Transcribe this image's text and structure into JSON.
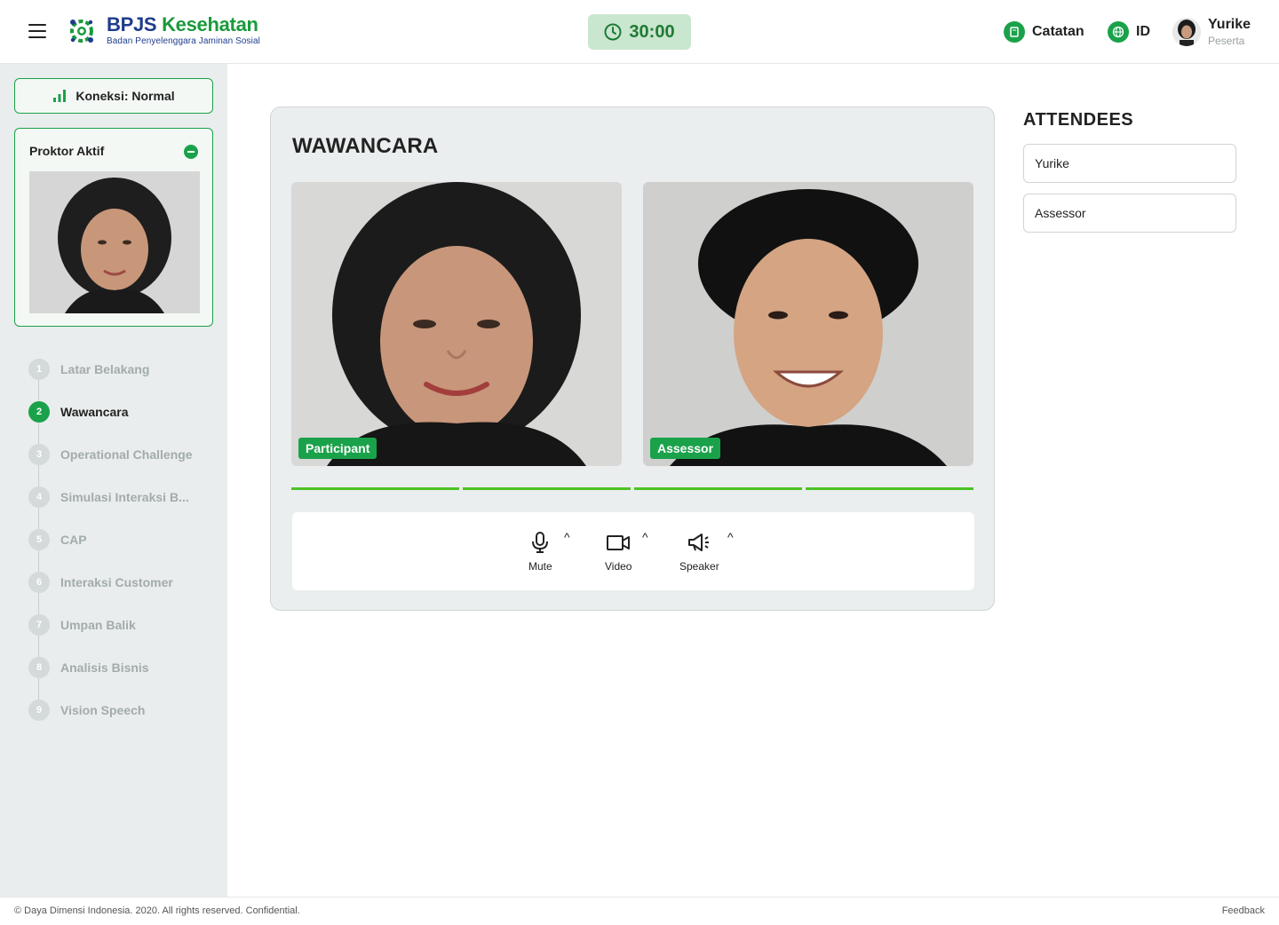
{
  "header": {
    "logo": {
      "title_part1": "BPJS",
      "title_part2": "Kesehatan",
      "subtitle": "Badan Penyelenggara Jaminan Sosial"
    },
    "timer": "30:00",
    "notes_label": "Catatan",
    "language": "ID",
    "user": {
      "name": "Yurike",
      "role": "Peserta"
    }
  },
  "sidebar": {
    "connection": "Koneksi: Normal",
    "proctor_title": "Proktor Aktif",
    "steps": [
      {
        "num": "1",
        "label": "Latar Belakang",
        "active": false
      },
      {
        "num": "2",
        "label": "Wawancara",
        "active": true
      },
      {
        "num": "3",
        "label": "Operational Challenge",
        "active": false
      },
      {
        "num": "4",
        "label": "Simulasi Interaksi B...",
        "active": false
      },
      {
        "num": "5",
        "label": "CAP",
        "active": false
      },
      {
        "num": "6",
        "label": "Interaksi Customer",
        "active": false
      },
      {
        "num": "7",
        "label": "Umpan Balik",
        "active": false
      },
      {
        "num": "8",
        "label": "Analisis Bisnis",
        "active": false
      },
      {
        "num": "9",
        "label": "Vision Speech",
        "active": false
      }
    ]
  },
  "main": {
    "title": "WAWANCARA",
    "videos": [
      {
        "label": "Participant"
      },
      {
        "label": "Assessor"
      }
    ],
    "controls": {
      "mute": "Mute",
      "video": "Video",
      "speaker": "Speaker",
      "caret": "^"
    }
  },
  "attendees": {
    "title": "ATTENDEES",
    "items": [
      "Yurike",
      "Assessor"
    ]
  },
  "footer": {
    "copyright": "© Daya Dimensi Indonesia. 2020. All rights reserved. Confidential.",
    "feedback": "Feedback"
  },
  "colors": {
    "brand_green": "#1aa24a",
    "brand_blue": "#1e3c8c",
    "audio_level": "#4cc325",
    "timer_bg": "#c9e6cf"
  },
  "icons": [
    "hamburger-icon",
    "clock-icon",
    "notes-icon",
    "globe-icon",
    "signal-bars-icon",
    "microphone-icon",
    "video-camera-icon",
    "speaker-icon"
  ]
}
